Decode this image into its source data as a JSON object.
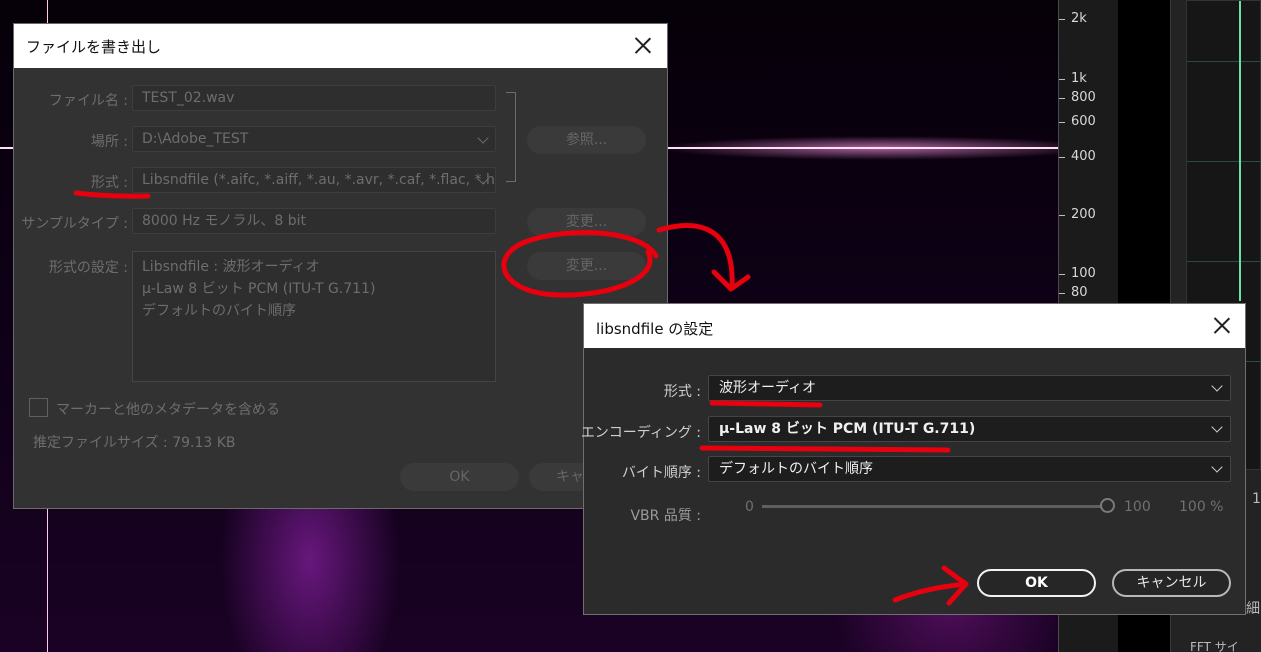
{
  "background": {
    "freq_scale": [
      "2k",
      "1k",
      "800",
      "600",
      "400",
      "200",
      "100",
      "80"
    ],
    "right_panel_text": [
      "1",
      "細",
      "FFT サイ"
    ]
  },
  "export_dialog": {
    "title": "ファイルを書き出し",
    "filename_label": "ファイル名 :",
    "filename_value": "TEST_02.wav",
    "location_label": "場所 :",
    "location_value": "D:\\Adobe_TEST",
    "browse_button": "参照...",
    "format_label": "形式 :",
    "format_value": "Libsndfile (*.aifc, *.aiff, *.au, *.avr, *.caf, *.flac, *.h...",
    "sample_type_label": "サンプルタイプ :",
    "sample_type_value": "8000 Hz モノラル、8 bit",
    "change_button_1": "変更...",
    "format_settings_label": "形式の設定 :",
    "format_settings_lines": [
      "Libsndfile : 波形オーディオ",
      "μ-Law 8 ビット PCM (ITU-T G.711)",
      "デフォルトのバイト順序"
    ],
    "change_button_2": "変更...",
    "include_markers_label": "マーカーと他のメタデータを含める",
    "estimated_size": "推定ファイルサイズ : 79.13 KB",
    "ok_button": "OK",
    "cancel_button": "キャ"
  },
  "libsndfile_dialog": {
    "title": "libsndfile の設定",
    "format_label": "形式 :",
    "format_value": "波形オーディオ",
    "encoding_label": "エンコーディング :",
    "encoding_value": "μ-Law 8 ビット PCM (ITU-T G.711)",
    "byte_order_label": "バイト順序 :",
    "byte_order_value": "デフォルトのバイト順序",
    "vbr_label": "VBR 品質 :",
    "vbr_min": "0",
    "vbr_max": "100",
    "vbr_value": "100 %",
    "ok_button": "OK",
    "cancel_button": "キャンセル"
  },
  "colors": {
    "annotation_red": "#e8000e",
    "accent_graph": "#68e0a8"
  }
}
